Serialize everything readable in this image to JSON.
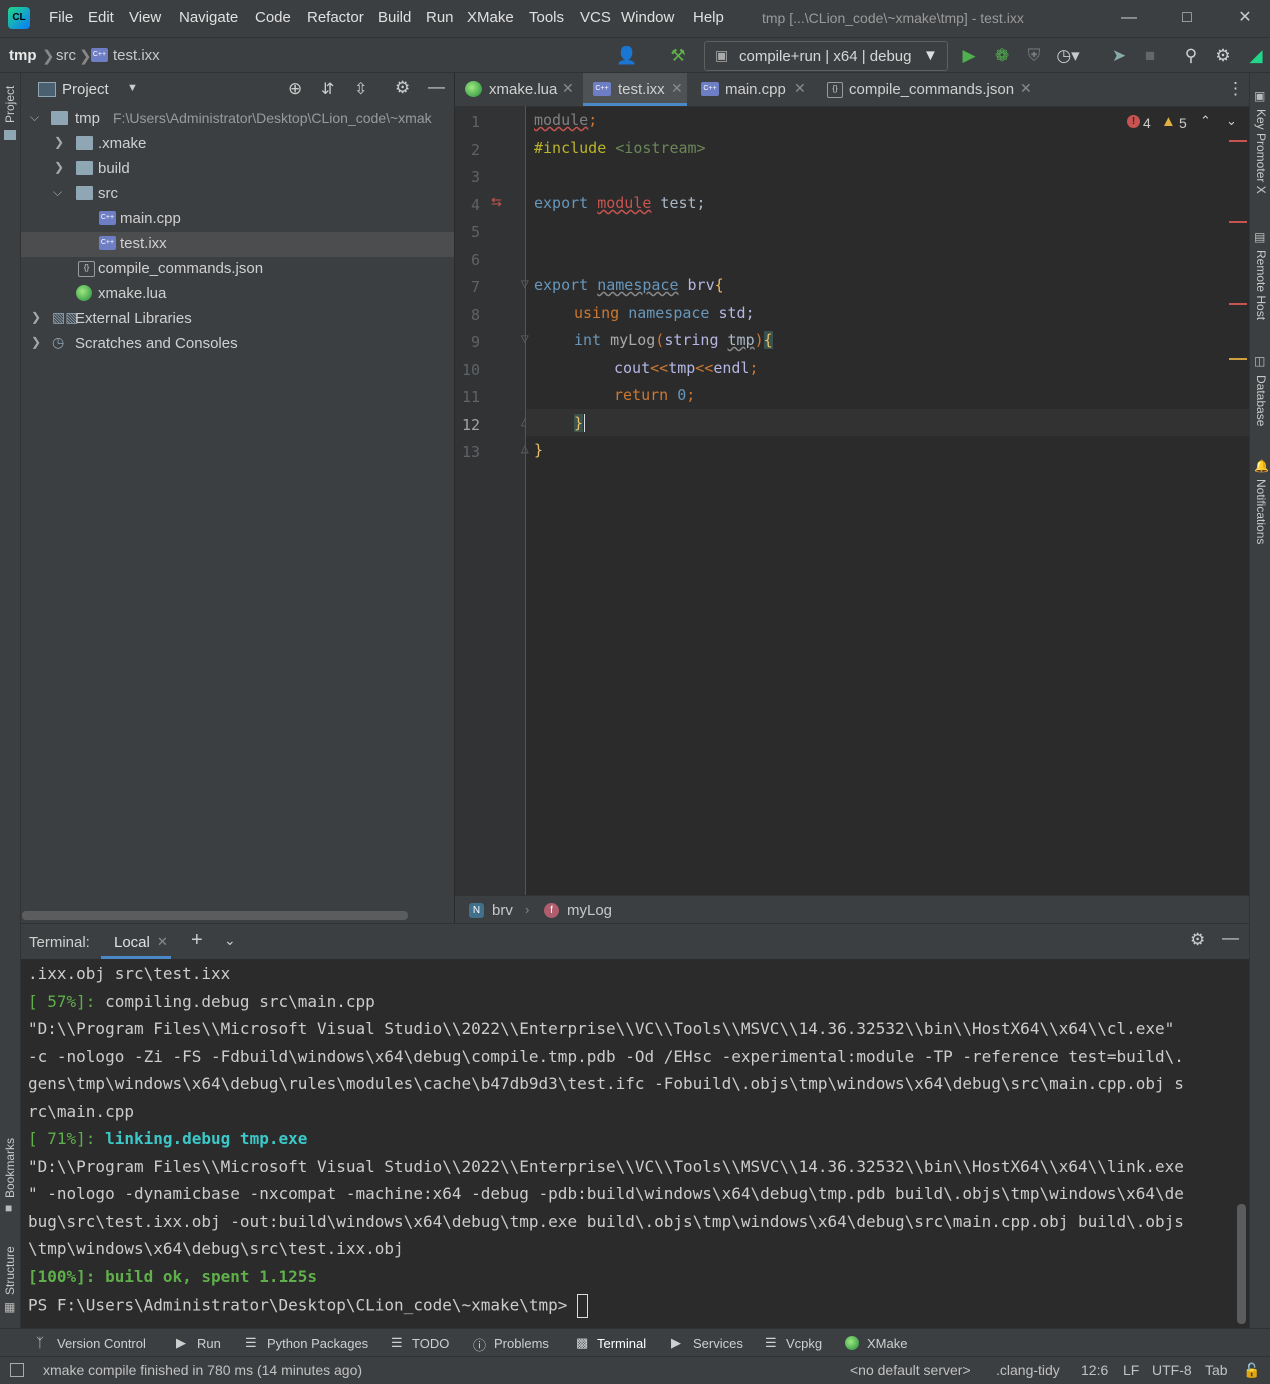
{
  "app": {
    "window_title": "tmp [...\\CLion_code\\~xmake\\tmp] - test.ixx",
    "menu": [
      "File",
      "Edit",
      "View",
      "Navigate",
      "Code",
      "Refactor",
      "Build",
      "Run",
      "XMake",
      "Tools",
      "VCS",
      "Window",
      "Help"
    ]
  },
  "navbar": {
    "breadcrumbs": [
      "tmp",
      "src",
      "test.ixx"
    ],
    "run_config": "compile+run | x64 | debug"
  },
  "left_strip": {
    "project": "Project",
    "bookmarks": "Bookmarks",
    "structure": "Structure"
  },
  "right_strip": {
    "key_promoter": "Key Promoter X",
    "remote_host": "Remote Host",
    "database": "Database",
    "notifications": "Notifications"
  },
  "project_panel": {
    "title": "Project",
    "root": {
      "name": "tmp",
      "path": "F:\\Users\\Administrator\\Desktop\\CLion_code\\~xmak"
    },
    "items": [
      {
        "name": ".xmake"
      },
      {
        "name": "build"
      },
      {
        "name": "src"
      },
      {
        "name": "main.cpp"
      },
      {
        "name": "test.ixx"
      },
      {
        "name": "compile_commands.json"
      },
      {
        "name": "xmake.lua"
      },
      {
        "name": "External Libraries"
      },
      {
        "name": "Scratches and Consoles"
      }
    ]
  },
  "editor": {
    "tabs": [
      {
        "label": "xmake.lua"
      },
      {
        "label": "test.ixx"
      },
      {
        "label": "main.cpp"
      },
      {
        "label": "compile_commands.json"
      }
    ],
    "errors": "4",
    "warnings": "5",
    "line_numbers": [
      "1",
      "2",
      "3",
      "4",
      "5",
      "6",
      "7",
      "8",
      "9",
      "10",
      "11",
      "12",
      "13"
    ],
    "code": {
      "l1_kw": "module",
      "l1_p": ";",
      "l2_pp": "#include",
      "l2_h": " <iostream>",
      "l4_kw": "export ",
      "l4_mod": "module",
      "l4_rest": " test;",
      "l7_kw": "export ",
      "l7_ns": "namespace",
      "l7_name": " brv",
      "l7_br": "{",
      "l8_kw": "using ",
      "l8_ns": "namespace",
      "l8_rest": " std;",
      "l9_kw": "int ",
      "l9_fn": "myLog",
      "l9_p1": "(",
      "l9_ty": "string",
      "l9_sp": " ",
      "l9_arg": "tmp",
      "l9_p2": ")",
      "l9_br": "{",
      "l10_a": "cout",
      "l10_b": "<<",
      "l10_c": "tmp",
      "l10_d": "<<",
      "l10_e": "endl",
      "l10_f": ";",
      "l11_kw": "return ",
      "l11_n": "0",
      "l11_p": ";",
      "l12": "}",
      "l13": "}"
    },
    "breadcrumb": [
      "brv",
      "myLog"
    ]
  },
  "terminal": {
    "title": "Terminal:",
    "tab": "Local",
    "lines": [
      ".ixx.obj src\\test.ixx",
      "[ 57%]: compiling.debug src\\main.cpp",
      "\"D:\\\\Program Files\\\\Microsoft Visual Studio\\\\2022\\\\Enterprise\\\\VC\\\\Tools\\\\MSVC\\\\14.36.32532\\\\bin\\\\HostX64\\\\x64\\\\cl.exe\"",
      "-c -nologo -Zi -FS -Fdbuild\\windows\\x64\\debug\\compile.tmp.pdb -Od /EHsc -experimental:module -TP -reference test=build\\.",
      "gens\\tmp\\windows\\x64\\debug\\rules\\modules\\cache\\b47db9d3\\test.ifc -Fobuild\\.objs\\tmp\\windows\\x64\\debug\\src\\main.cpp.obj s",
      "rc\\main.cpp",
      "[ 71%]: linking.debug tmp.exe",
      "\"D:\\\\Program Files\\\\Microsoft Visual Studio\\\\2022\\\\Enterprise\\\\VC\\\\Tools\\\\MSVC\\\\14.36.32532\\\\bin\\\\HostX64\\\\x64\\\\link.exe",
      "\" -nologo -dynamicbase -nxcompat -machine:x64 -debug -pdb:build\\windows\\x64\\debug\\tmp.pdb build\\.objs\\tmp\\windows\\x64\\de",
      "bug\\src\\test.ixx.obj -out:build\\windows\\x64\\debug\\tmp.exe build\\.objs\\tmp\\windows\\x64\\debug\\src\\main.cpp.obj build\\.objs",
      "\\tmp\\windows\\x64\\debug\\src\\test.ixx.obj",
      "[100%]: build ok, spent 1.125s",
      "PS F:\\Users\\Administrator\\Desktop\\CLion_code\\~xmake\\tmp> "
    ],
    "prefix_57": "[ 57%]:",
    "prefix_71": "[ 71%]:"
  },
  "toolwindows": [
    "Version Control",
    "Run",
    "Python Packages",
    "TODO",
    "Problems",
    "Terminal",
    "Services",
    "Vcpkg",
    "XMake"
  ],
  "status": {
    "message": "xmake compile finished in 780 ms (14 minutes ago)",
    "server": "<no default server>",
    "inspector": ".clang-tidy",
    "position": "12:6",
    "line_sep": "LF",
    "encoding": "UTF-8",
    "indent": "Tab"
  },
  "colors": {
    "keyword": "#cc7832",
    "blue_kw": "#6897bb",
    "accent": "#4a88c7",
    "ok": "#6a8759",
    "terminal_green": "#5fb04a",
    "terminal_cyan": "#3cc8c8"
  }
}
